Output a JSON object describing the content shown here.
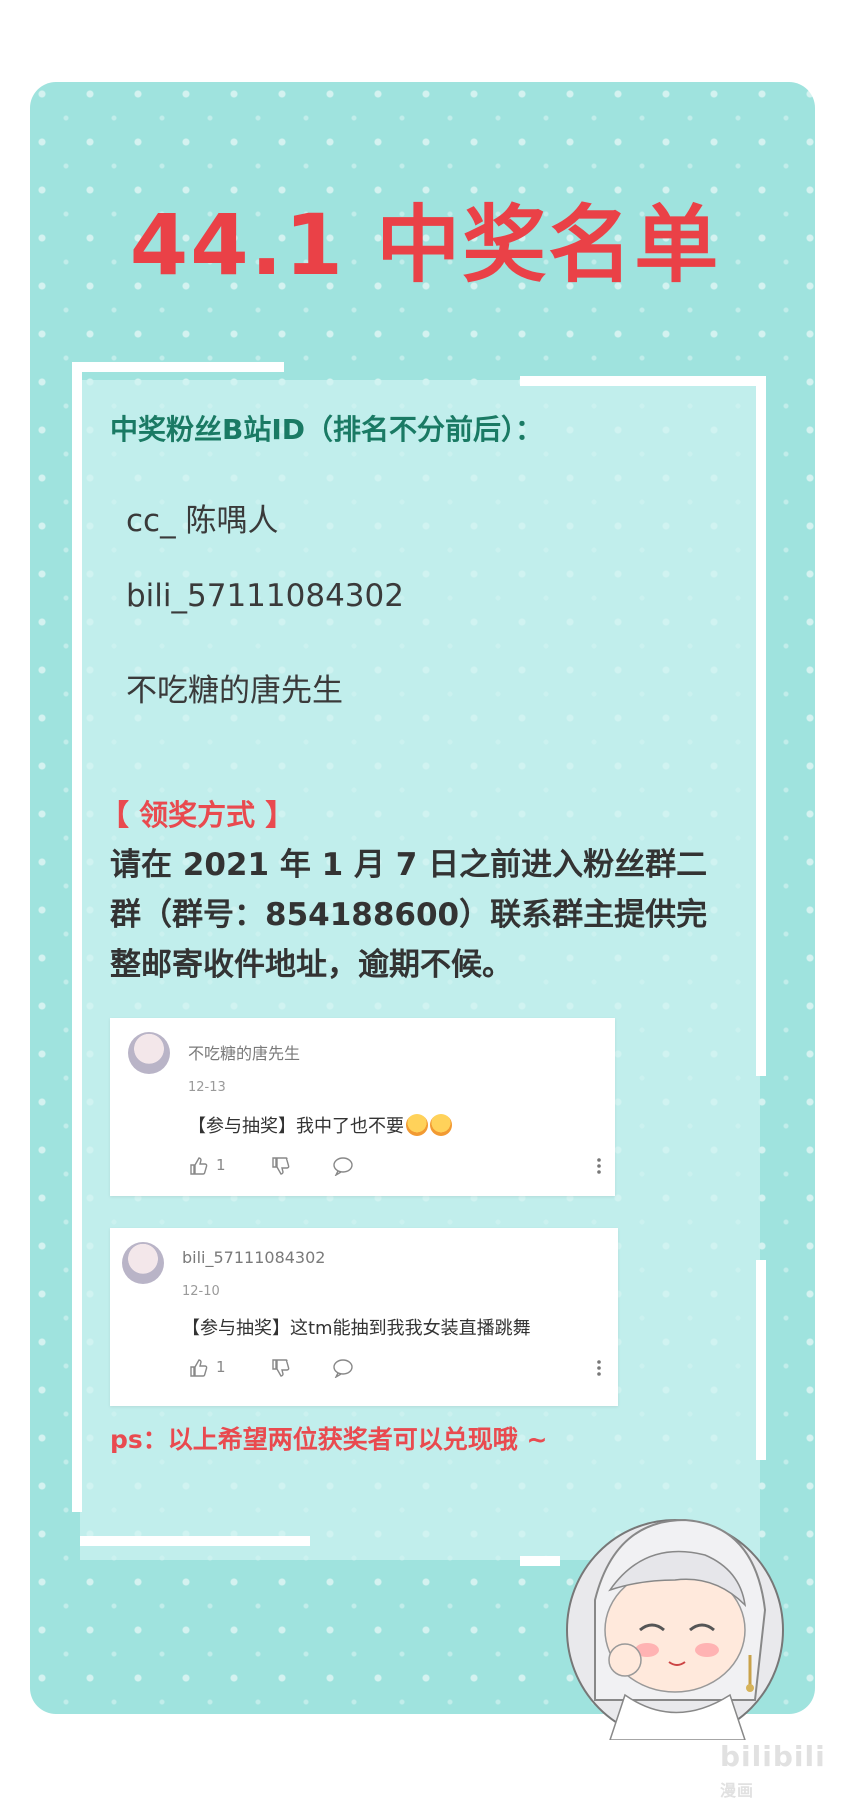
{
  "title": "44.1 中奖名单",
  "winners_heading": "中奖粉丝B站ID（排名不分前后）：",
  "winners": [
    "cc_ 陈喁人",
    "bili_57111084302",
    "不吃糖的唐先生"
  ],
  "claim": {
    "label": "【 领奖方式 】",
    "body": "请在 2021 年 1 月 7 日之前进入粉丝群二群（群号：854188600）联系群主提供完整邮寄收件地址，逾期不候。"
  },
  "comments": [
    {
      "username": "不吃糖的唐先生",
      "date": "12-13",
      "text": "【参与抽奖】我中了也不要",
      "likes": "1"
    },
    {
      "username": "bili_57111084302",
      "date": "12-10",
      "text": "【参与抽奖】这tm能抽到我我女装直播跳舞",
      "likes": "1"
    }
  ],
  "ps": "ps：以上希望两位获奖者可以兑现哦 ~",
  "watermark": {
    "main": "bilibili",
    "sub": "漫画"
  },
  "colors": {
    "background": "#9fe3de",
    "title": "#ea4147",
    "heading": "#1a7a64",
    "claim_label": "#e94a4f"
  },
  "icons": [
    "thumbs-up-icon",
    "thumbs-down-icon",
    "reply-icon",
    "more-icon",
    "avatar",
    "emoji-icon"
  ]
}
